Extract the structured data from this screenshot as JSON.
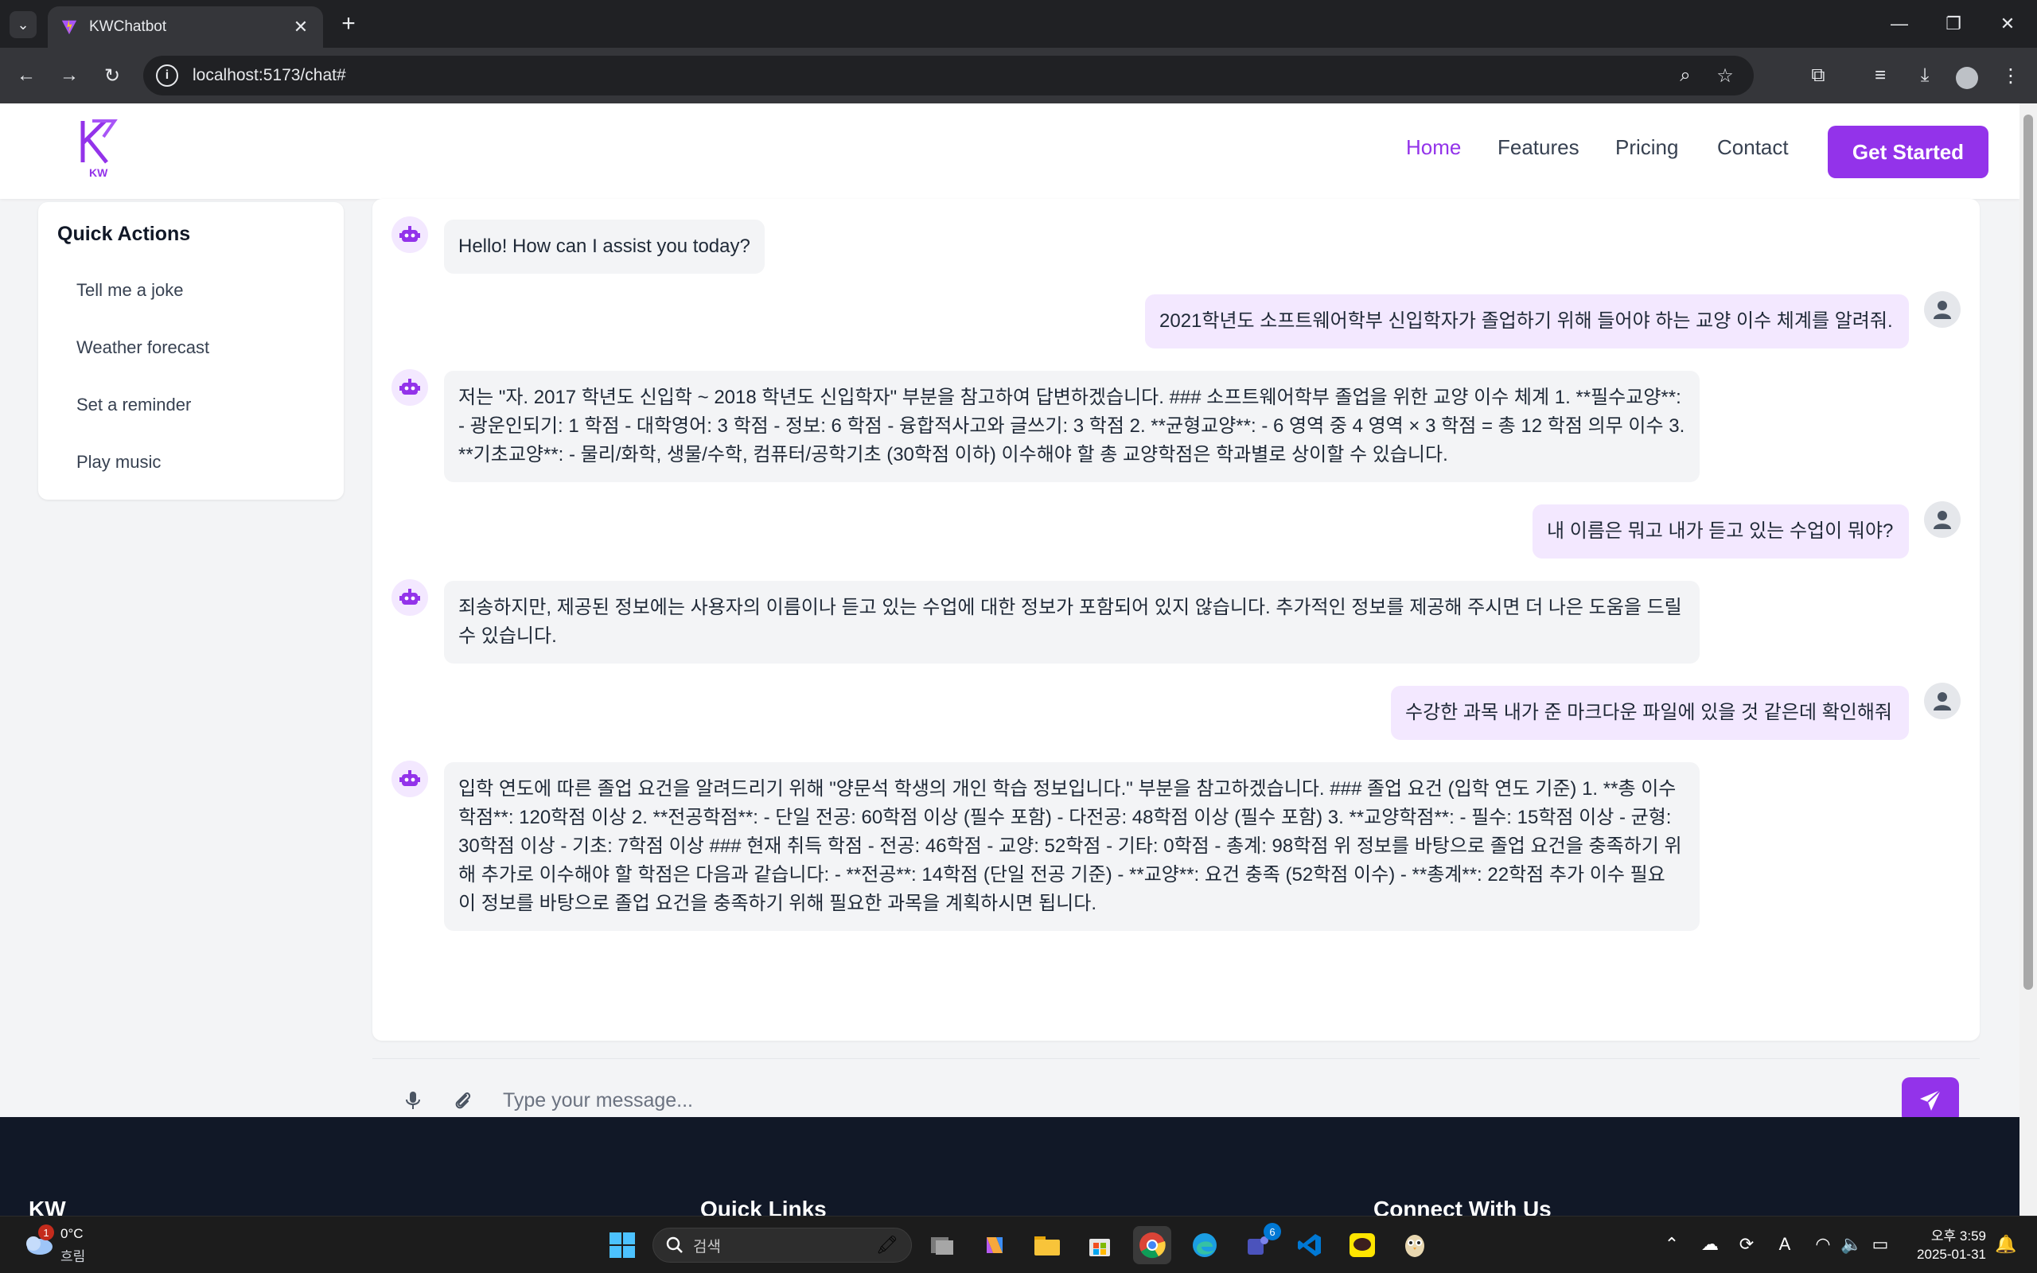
{
  "browser": {
    "tab_title": "KWChatbot",
    "url": "localhost:5173/chat#"
  },
  "header": {
    "logo_text": "KW",
    "nav": [
      {
        "label": "Home",
        "active": true
      },
      {
        "label": "Features",
        "active": false
      },
      {
        "label": "Pricing",
        "active": false
      },
      {
        "label": "Contact",
        "active": false
      }
    ],
    "cta_label": "Get Started"
  },
  "sidebar": {
    "title": "Quick Actions",
    "items": [
      "Tell me a joke",
      "Weather forecast",
      "Set a reminder",
      "Play music"
    ]
  },
  "chat": {
    "messages": [
      {
        "role": "bot",
        "text": "Hello! How can I assist you today?"
      },
      {
        "role": "user",
        "text": "2021학년도 소프트웨어학부 신입학자가 졸업하기 위해 들어야 하는 교양 이수 체계를 알려줘."
      },
      {
        "role": "bot",
        "text": "저는 \"자. 2017 학년도 신입학 ~ 2018 학년도 신입학자\" 부분을 참고하여 답변하겠습니다. ### 소프트웨어학부 졸업을 위한 교양 이수 체계 1. **필수교양**: - 광운인되기: 1 학점 - 대학영어: 3 학점 - 정보: 6 학점 - 융합적사고와 글쓰기: 3 학점 2. **균형교양**: - 6 영역 중 4 영역 × 3 학점 = 총 12 학점 의무 이수 3. **기초교양**: - 물리/화학, 생물/수학, 컴퓨터/공학기초 (30학점 이하) 이수해야 할 총 교양학점은 학과별로 상이할 수 있습니다."
      },
      {
        "role": "user",
        "text": "내 이름은 뭐고 내가 듣고 있는 수업이 뭐야?"
      },
      {
        "role": "bot",
        "text": "죄송하지만, 제공된 정보에는 사용자의 이름이나 듣고 있는 수업에 대한 정보가 포함되어 있지 않습니다. 추가적인 정보를 제공해 주시면 더 나은 도움을 드릴 수 있습니다."
      },
      {
        "role": "user",
        "text": "수강한 과목 내가 준 마크다운 파일에 있을 것 같은데 확인해줘"
      },
      {
        "role": "bot",
        "text": "입학 연도에 따른 졸업 요건을 알려드리기 위해 \"양문석 학생의 개인 학습 정보입니다.\" 부분을 참고하겠습니다. ### 졸업 요건 (입학 연도 기준) 1. **총 이수학점**: 120학점 이상 2. **전공학점**: - 단일 전공: 60학점 이상 (필수 포함) - 다전공: 48학점 이상 (필수 포함) 3. **교양학점**: - 필수: 15학점 이상 - 균형: 30학점 이상 - 기초: 7학점 이상 ### 현재 취득 학점 - 전공: 46학점 - 교양: 52학점 - 기타: 0학점 - 총계: 98학점 위 정보를 바탕으로 졸업 요건을 충족하기 위해 추가로 이수해야 할 학점은 다음과 같습니다: - **전공**: 14학점 (단일 전공 기준) - **교양**: 요건 충족 (52학점 이수) - **총계**: 22학점 추가 이수 필요 이 정보를 바탕으로 졸업 요건을 충족하기 위해 필요한 과목을 계획하시면 됩니다."
      }
    ],
    "input_placeholder": "Type your message..."
  },
  "footer": {
    "headings": [
      "KW",
      "Quick Links",
      "Connect With Us"
    ]
  },
  "taskbar": {
    "weather_temp": "0°C",
    "weather_condition": "흐림",
    "weather_badge": "1",
    "search_label": "검색",
    "teams_badge": "6",
    "time": "오후 3:59",
    "date": "2025-01-31"
  },
  "colors": {
    "accent": "#9333ea",
    "user_bubble": "#f3e8ff",
    "bot_bubble": "#f3f4f6",
    "footer_bg": "#111827"
  }
}
